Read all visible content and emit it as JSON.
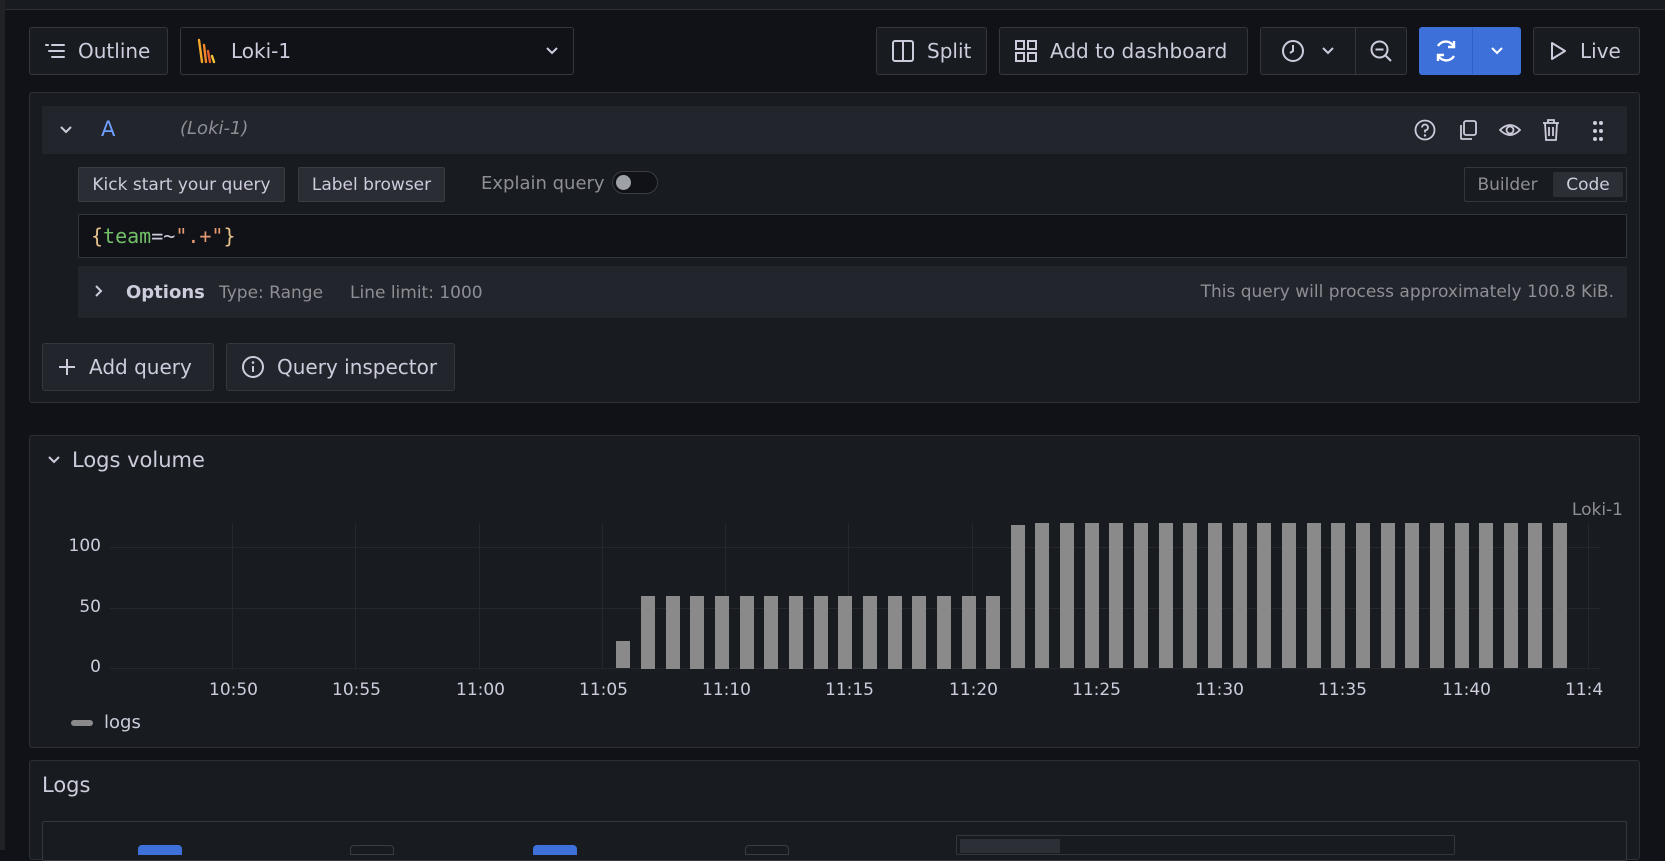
{
  "toolbar": {
    "outline_label": "Outline",
    "datasource_name": "Loki-1",
    "split_label": "Split",
    "add_to_dashboard_label": "Add to dashboard",
    "live_label": "Live",
    "accent_color": "#3d71d9"
  },
  "query": {
    "ref_id": "A",
    "datasource_hint": "(Loki-1)",
    "kick_start_label": "Kick start your query",
    "label_browser_label": "Label browser",
    "explain_query_label": "Explain query",
    "explain_query_enabled": false,
    "mode_builder_label": "Builder",
    "mode_code_label": "Code",
    "mode_selected": "Code",
    "expression": {
      "open_brace": "{",
      "label": "team",
      "operator": "=~",
      "value": "\".+\"",
      "close_brace": "}"
    },
    "options_label": "Options",
    "type_text": "Type: Range",
    "line_limit_text": "Line limit: 1000",
    "process_estimate": "This query will process approximately 100.8 KiB."
  },
  "actions": {
    "add_query_label": "Add query",
    "query_inspector_label": "Query inspector"
  },
  "logs_volume": {
    "title": "Logs volume",
    "datasource_label": "Loki-1",
    "legend_label": "logs"
  },
  "logs": {
    "title": "Logs"
  },
  "chart_data": {
    "type": "bar",
    "title": "",
    "xlabel": "",
    "ylabel": "",
    "ylim": [
      0,
      120
    ],
    "yticks": [
      "0",
      "50",
      "100"
    ],
    "xticks": [
      "10:50",
      "10:55",
      "11:00",
      "11:05",
      "11:10",
      "11:15",
      "11:20",
      "11:25",
      "11:30",
      "11:35",
      "11:40",
      "11:4"
    ],
    "series": [
      {
        "name": "logs",
        "color": "#8a8a8a",
        "points": [
          {
            "t": "11:06",
            "v": 22
          },
          {
            "t": "11:07",
            "v": 60
          },
          {
            "t": "11:08",
            "v": 60
          },
          {
            "t": "11:09",
            "v": 60
          },
          {
            "t": "11:10",
            "v": 60
          },
          {
            "t": "11:11",
            "v": 60
          },
          {
            "t": "11:12",
            "v": 60
          },
          {
            "t": "11:13",
            "v": 60
          },
          {
            "t": "11:14",
            "v": 60
          },
          {
            "t": "11:15",
            "v": 60
          },
          {
            "t": "11:16",
            "v": 60
          },
          {
            "t": "11:17",
            "v": 60
          },
          {
            "t": "11:18",
            "v": 60
          },
          {
            "t": "11:19",
            "v": 60
          },
          {
            "t": "11:20",
            "v": 60
          },
          {
            "t": "11:21",
            "v": 60
          },
          {
            "t": "11:22",
            "v": 118
          },
          {
            "t": "11:23",
            "v": 120
          },
          {
            "t": "11:24",
            "v": 120
          },
          {
            "t": "11:25",
            "v": 120
          },
          {
            "t": "11:26",
            "v": 120
          },
          {
            "t": "11:27",
            "v": 120
          },
          {
            "t": "11:28",
            "v": 120
          },
          {
            "t": "11:29",
            "v": 120
          },
          {
            "t": "11:30",
            "v": 120
          },
          {
            "t": "11:31",
            "v": 120
          },
          {
            "t": "11:32",
            "v": 120
          },
          {
            "t": "11:33",
            "v": 120
          },
          {
            "t": "11:34",
            "v": 120
          },
          {
            "t": "11:35",
            "v": 120
          },
          {
            "t": "11:36",
            "v": 120
          },
          {
            "t": "11:37",
            "v": 120
          },
          {
            "t": "11:38",
            "v": 120
          },
          {
            "t": "11:39",
            "v": 120
          },
          {
            "t": "11:40",
            "v": 120
          },
          {
            "t": "11:41",
            "v": 120
          },
          {
            "t": "11:42",
            "v": 120
          },
          {
            "t": "11:43",
            "v": 120
          },
          {
            "t": "11:44",
            "v": 120
          }
        ]
      }
    ]
  }
}
